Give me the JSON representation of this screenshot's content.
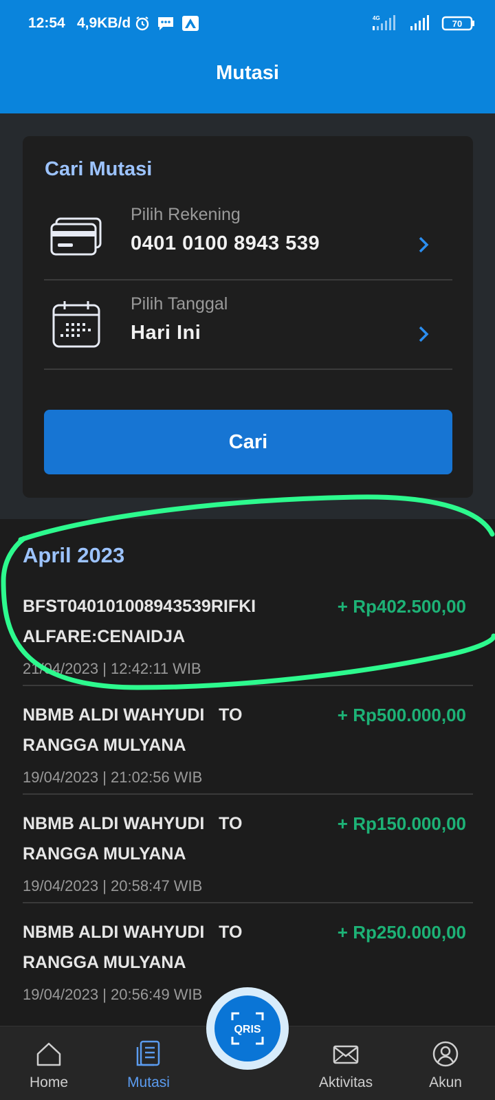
{
  "status_bar": {
    "time": "12:54",
    "speed": "4,9KB/d",
    "network": "4G",
    "battery": "70",
    "icons": [
      "alarm-icon",
      "message-icon",
      "app-notification-icon",
      "signal-icon",
      "wifi-signal-icon",
      "battery-icon"
    ]
  },
  "header": {
    "title": "Mutasi"
  },
  "search_card": {
    "title": "Cari Mutasi",
    "account": {
      "label": "Pilih Rekening",
      "value": "0401 0100 8943 539"
    },
    "date": {
      "label": "Pilih Tanggal",
      "value": "Hari Ini"
    },
    "search_button": "Cari"
  },
  "transactions": {
    "month": "April 2023",
    "items": [
      {
        "description": "BFST040101008943539RIFKI\nALFARE:CENAIDJA",
        "amount": "+ Rp402.500,00",
        "datetime": "21/04/2023 | 12:42:11 WIB"
      },
      {
        "description": "NBMB ALDI WAHYUDI   TO\nRANGGA MULYANA",
        "amount": "+ Rp500.000,00",
        "datetime": "19/04/2023 | 21:02:56 WIB"
      },
      {
        "description": "NBMB ALDI WAHYUDI   TO\nRANGGA MULYANA",
        "amount": "+ Rp150.000,00",
        "datetime": "19/04/2023 | 20:58:47 WIB"
      },
      {
        "description": "NBMB ALDI WAHYUDI   TO\nRANGGA MULYANA",
        "amount": "+ Rp250.000,00",
        "datetime": "19/04/2023 | 20:56:49 WIB"
      }
    ]
  },
  "bottom_nav": {
    "items": [
      {
        "label": "Home",
        "icon": "home-icon"
      },
      {
        "label": "Mutasi",
        "icon": "document-icon"
      },
      {
        "label": "Aktivitas",
        "icon": "envelope-icon"
      },
      {
        "label": "Akun",
        "icon": "user-icon"
      }
    ],
    "center_button": {
      "label": "QRIS",
      "icon": "qris-scan-icon"
    }
  },
  "colors": {
    "header": "#0a84dc",
    "accent": "#1775d3",
    "month_label": "#9cc3ff",
    "amount_positive": "#1db276",
    "highlight_annotation": "#2dfa8e"
  }
}
